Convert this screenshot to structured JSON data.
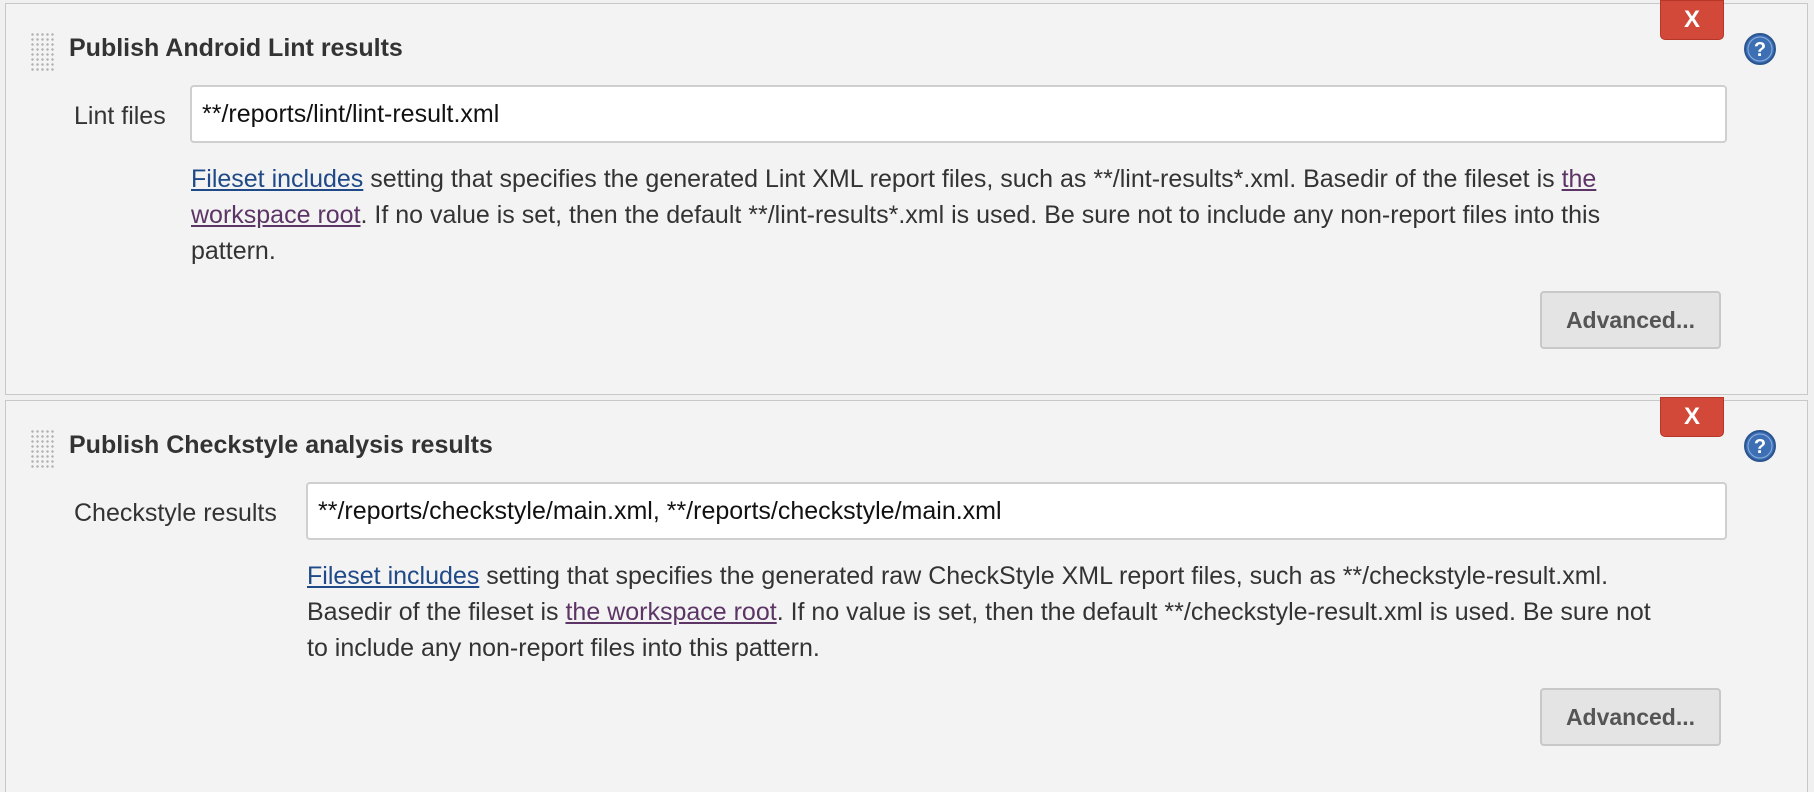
{
  "sections": [
    {
      "title": "Publish Android Lint results",
      "delete_label": "X",
      "field_label": "Lint files",
      "field_value": "**/reports/lint/lint-result.xml",
      "help": {
        "link1": "Fileset includes",
        "text1": " setting that specifies the generated Lint XML report files, such as **/lint-results*.xml. Basedir of the fileset is ",
        "link2": "the workspace root",
        "text2": ". If no value is set, then the default **/lint-results*.xml is used. Be sure not to include any non-report files into this pattern."
      },
      "advanced_label": "Advanced..."
    },
    {
      "title": "Publish Checkstyle analysis results",
      "delete_label": "X",
      "field_label": "Checkstyle results",
      "field_value": "**/reports/checkstyle/main.xml, **/reports/checkstyle/main.xml",
      "help": {
        "link1": "Fileset includes",
        "text1": " setting that specifies the generated raw CheckStyle XML report files, such as **/checkstyle-result.xml. Basedir of the fileset is ",
        "link2": "the workspace root",
        "text2": ". If no value is set, then the default **/checkstyle-result.xml is used. Be sure not to include any non-report files into this pattern."
      },
      "advanced_label": "Advanced..."
    }
  ],
  "colors": {
    "delete_button": "#d24939",
    "help_icon": "#3d6fb4",
    "link_unvisited": "#204a87",
    "link_visited": "#5c3566"
  },
  "icons": {
    "help": "question-circle-icon",
    "drag": "drag-handle-icon"
  }
}
